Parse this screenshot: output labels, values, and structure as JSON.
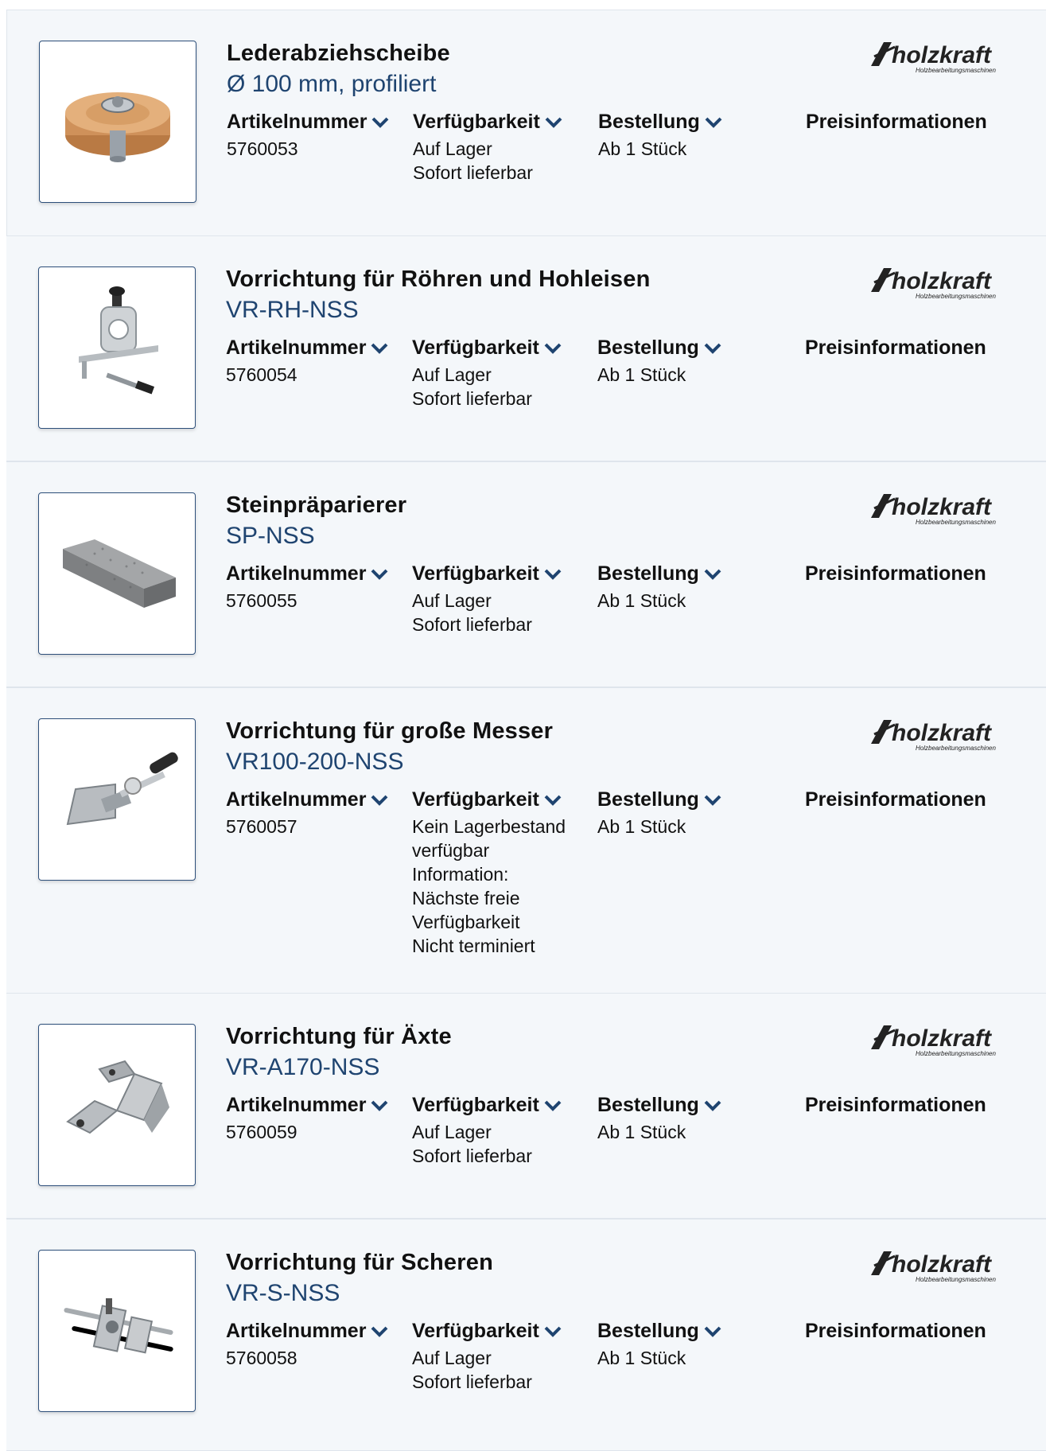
{
  "labels": {
    "article": "Artikelnummer",
    "availability": "Verfügbarkeit",
    "order": "Bestellung",
    "price": "Preisinformationen"
  },
  "brand": {
    "logo_text": "holzkraft",
    "logo_subtext": "Holzbearbeitungsmaschinen",
    "accent_color": "#1f4470"
  },
  "products": [
    {
      "title": "Lederabziehscheibe",
      "subtitle": "Ø 100 mm, profiliert",
      "article_number": "5760053",
      "availability": [
        "Auf Lager",
        "Sofort lieferbar"
      ],
      "order": "Ab 1 Stück",
      "image_icon": "leather-wheel-icon"
    },
    {
      "title": "Vorrichtung für Röhren und Hohleisen",
      "subtitle": "VR-RH-NSS",
      "article_number": "5760054",
      "availability": [
        "Auf Lager",
        "Sofort lieferbar"
      ],
      "order": "Ab 1 Stück",
      "image_icon": "gouge-jig-icon"
    },
    {
      "title": "Steinpräparierer",
      "subtitle": "SP-NSS",
      "article_number": "5760055",
      "availability": [
        "Auf Lager",
        "Sofort lieferbar"
      ],
      "order": "Ab 1 Stück",
      "image_icon": "stone-grader-icon"
    },
    {
      "title": "Vorrichtung für große Messer",
      "subtitle": "VR100-200-NSS",
      "article_number": "5760057",
      "availability": [
        "Kein Lagerbestand",
        "verfügbar",
        "Information:",
        "Nächste freie",
        "Verfügbarkeit",
        "Nicht terminiert"
      ],
      "order": "Ab 1 Stück",
      "image_icon": "knife-jig-icon"
    },
    {
      "title": "Vorrichtung für Äxte",
      "subtitle": "VR-A170-NSS",
      "article_number": "5760059",
      "availability": [
        "Auf Lager",
        "Sofort lieferbar"
      ],
      "order": "Ab 1 Stück",
      "image_icon": "axe-jig-icon"
    },
    {
      "title": "Vorrichtung für Scheren",
      "subtitle": "VR-S-NSS",
      "article_number": "5760058",
      "availability": [
        "Auf Lager",
        "Sofort lieferbar"
      ],
      "order": "Ab 1 Stück",
      "image_icon": "scissors-jig-icon"
    }
  ]
}
